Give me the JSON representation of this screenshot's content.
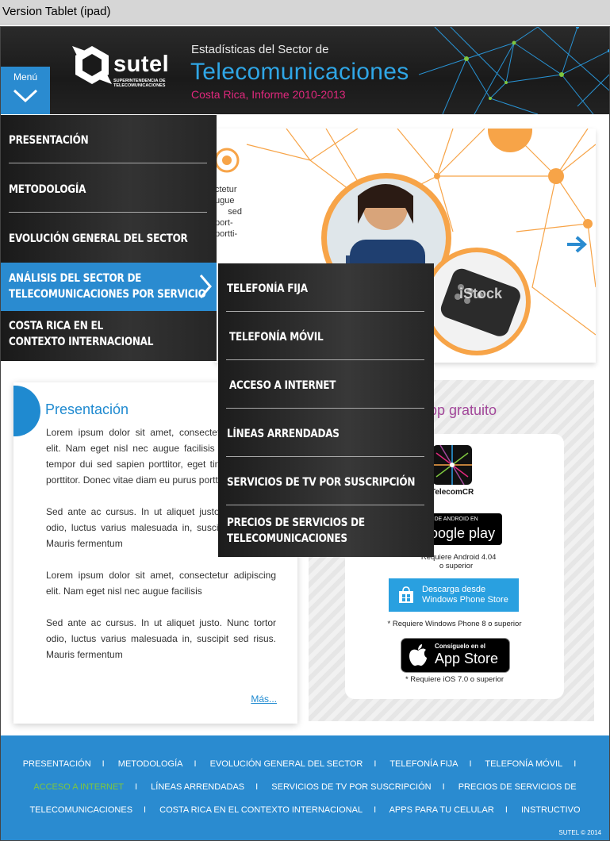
{
  "device_label": "Version Tablet (ipad)",
  "menu_button": {
    "label": "Menú"
  },
  "logo": {
    "word": "sutel",
    "sub": "SUPERINTENDENCIA DE TELECOMUNICACIONES"
  },
  "banner": {
    "line1": "Estadísticas del Sector de",
    "line2": "Telecomunicaciones",
    "line3": "Costa Rica, Informe 2010-2013"
  },
  "menu": {
    "items": [
      {
        "label": "PRESENTACIÓN"
      },
      {
        "label": "METODOLOGÍA"
      },
      {
        "label": "EVOLUCIÓN GENERAL DEL SECTOR"
      },
      {
        "label1": "ANÁLISIS DEL SECTOR DE",
        "label2": "TELECOMUNICACIONES POR SERVICIO"
      },
      {
        "label1": "COSTA RICA EN EL",
        "label2": "CONTEXTO INTERNACIONAL"
      }
    ],
    "submenu": [
      {
        "label": "TELEFONÍA FIJA"
      },
      {
        "label": "TELEFONÍA MÓVIL"
      },
      {
        "label": "ACCESO A INTERNET"
      },
      {
        "label": "LÍNEAS ARRENDADAS"
      },
      {
        "label": "SERVICIOS DE TV POR SUSCRIPCIÓN"
      },
      {
        "label1": "PRECIOS DE SERVICIOS DE",
        "label2": "TELECOMUNICACIONES"
      }
    ]
  },
  "hero": {
    "text_fragments": [
      "ctetur",
      "ugue",
      "sed",
      "port-",
      "portti-"
    ],
    "watermark": "iStock"
  },
  "presentation": {
    "title": "Presentación",
    "paragraphs": [
      "Lorem ipsum dolor sit amet, consectetur adipiscing elit. Nam eget nisl nec augue facilisis ultricies. Sed tempor dui sed sapien porttitor, eget tincidunt neque porttitor. Donec vitae diam eu purus portti",
      "Sed ante ac cursus. In ut aliquet justo. Nunc tortor odio, luctus varius malesuada in, suscipit sed risus. Mauris fermentum",
      "Lorem ipsum dolor sit amet, consectetur adipiscing elit. Nam eget nisl nec augue facilisis",
      "Sed ante ac cursus. In ut aliquet justo. Nunc tortor odio, luctus varius malesuada in, suscipit sed risus. Mauris fermentum"
    ],
    "more": "Más..."
  },
  "apps": {
    "title": "pp gratuito",
    "app_name": "TelecomCR",
    "gplay_small": "CIÓN DE ANDROID EN",
    "gplay_big": "Google play",
    "req_android_1": "* Requiere Android 4.04",
    "req_android_2": "o superior",
    "win_1": "Descarga desde",
    "win_2": "Windows Phone Store",
    "req_windows": "* Requiere Windows Phone 8 o superior",
    "appstore_small": "Consíguelo en el",
    "appstore_big": "App Store",
    "req_ios": "* Requiere iOS 7.0 o superior"
  },
  "footer": {
    "row1": [
      "PRESENTACIÓN",
      "METODOLOGÍA",
      "EVOLUCIÓN GENERAL DEL SECTOR",
      "TELEFONÍA FIJA",
      "TELEFONÍA MÓVIL"
    ],
    "row2": [
      "ACCESO A INTERNET",
      "LÍNEAS ARRENDADAS",
      "SERVICIOS DE TV POR SUSCRIPCIÓN",
      "PRECIOS DE SERVICIOS DE"
    ],
    "row3": [
      "TELECOMUNICACIONES",
      "COSTA RICA EN EL CONTEXTO INTERNACIONAL",
      "APPS PARA TU CELULAR",
      "INSTRUCTIVO"
    ],
    "active_color": "#7ec63f",
    "copyright": "SUTEL ©  2014"
  },
  "colors": {
    "accent": "#2a8bd0",
    "magenta": "#e0287d",
    "purple": "#a2479a",
    "orange": "#f7a448"
  }
}
